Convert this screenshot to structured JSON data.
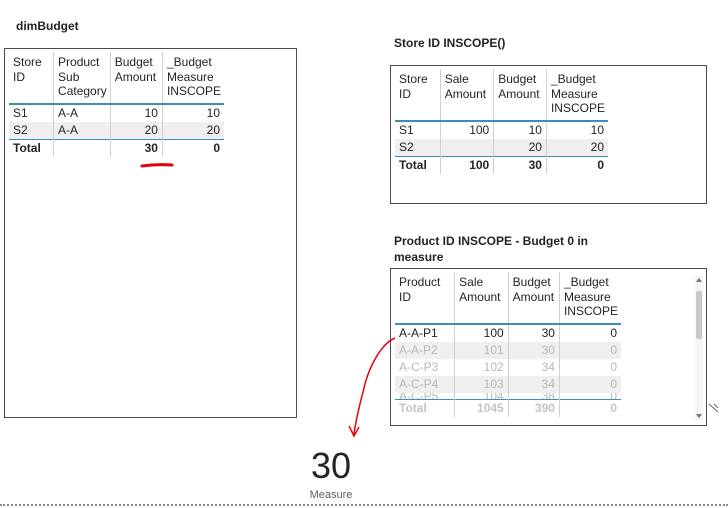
{
  "visuals": {
    "dim_budget": {
      "title": "dimBudget",
      "headers": [
        "Store ID",
        "Product Sub Category",
        "Budget Amount",
        "_Budget Measure INSCOPE"
      ],
      "rows": [
        [
          "S1",
          "A-A",
          "10",
          "10"
        ],
        [
          "S2",
          "A-A",
          "20",
          "20"
        ]
      ],
      "total": [
        "Total",
        "",
        "30",
        "0"
      ]
    },
    "store_inscope": {
      "title": "Store ID INSCOPE()",
      "headers": [
        "Store ID",
        "Sale Amount",
        "Budget Amount",
        "_Budget Measure INSCOPE"
      ],
      "rows": [
        [
          "S1",
          "100",
          "10",
          "10"
        ],
        [
          "S2",
          "",
          "20",
          "20"
        ]
      ],
      "total": [
        "Total",
        "100",
        "30",
        "0"
      ]
    },
    "product_inscope": {
      "title": "Product ID INSCOPE - Budget 0 in measure",
      "headers": [
        "Product ID",
        "Sale Amount",
        "Budget Amount",
        "_Budget Measure INSCOPE"
      ],
      "rows": [
        [
          "A-A-P1",
          "100",
          "30",
          "0"
        ],
        [
          "A-A-P2",
          "101",
          "30",
          "0"
        ],
        [
          "A-C-P3",
          "102",
          "34",
          "0"
        ],
        [
          "A-C-P4",
          "103",
          "34",
          "0"
        ],
        [
          "A-C-P5",
          "104",
          "38",
          "0"
        ]
      ],
      "total": [
        "Total",
        "1045",
        "390",
        "0"
      ]
    },
    "card": {
      "value": "30",
      "label": "Measure"
    }
  },
  "colors": {
    "header_underline": "#3a8fb7",
    "annotation_red": "#e8000b",
    "row_alt": "#efefef",
    "faded_text": "#b8b8b8"
  },
  "icons": [
    "scroll-up-icon",
    "scroll-down-icon",
    "resize-handle-icon"
  ]
}
